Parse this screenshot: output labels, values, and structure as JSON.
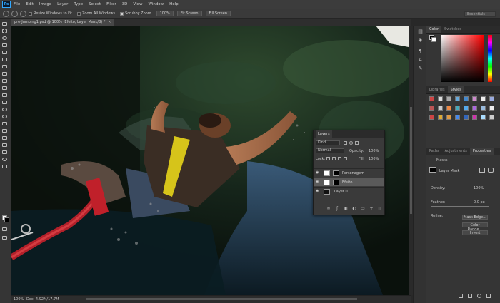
{
  "app": {
    "logo": "Ps"
  },
  "menu": [
    "File",
    "Edit",
    "Image",
    "Layer",
    "Type",
    "Select",
    "Filter",
    "3D",
    "View",
    "Window",
    "Help"
  ],
  "options_bar": {
    "resize_windows_label": "Resize Windows to Fit",
    "zoom_all_windows_label": "Zoom All Windows",
    "scrubby_zoom_label": "Scrubby Zoom",
    "btn_100": "100%",
    "btn_fit_screen": "Fit Screen",
    "btn_fill_screen": "Fill Screen",
    "workspace": "Essentials"
  },
  "document": {
    "tab_title": "pre-Jumping1.psd @ 100% (Efeito, Layer Mask/8) *",
    "close_glyph": "×",
    "zoom": "100%",
    "doc_info": "Doc: 4.92M/17.7M"
  },
  "color_panel": {
    "tabs": [
      "Color",
      "Swatches"
    ]
  },
  "styles_panel": {
    "tabs": [
      "Libraries",
      "Styles"
    ],
    "swatch_colors": [
      "#c44",
      "#ddd",
      "#aaa",
      "#6ad",
      "#48c",
      "#c8c",
      "#eee",
      "#9ad",
      "#b55",
      "#ccc",
      "#e84",
      "#4ab",
      "#5ae",
      "#a6d",
      "#9bd",
      "#eee",
      "#c44",
      "#da3",
      "#d94",
      "#48e",
      "#36b",
      "#c3a",
      "#adf",
      "#ccc"
    ]
  },
  "properties_panel": {
    "tabs": [
      "Paths",
      "Adjustments",
      "Properties"
    ],
    "masks_label": "Masks",
    "layer_mask_label": "Layer Mask",
    "density_label": "Density:",
    "density_value": "100%",
    "feather_label": "Feather:",
    "feather_value": "0.0 px",
    "refine_label": "Refine:",
    "mask_edge_btn": "Mask Edge...",
    "color_range_btn": "Color Range...",
    "invert_btn": "Invert"
  },
  "layers_panel": {
    "tab": "Layers",
    "kind_label": "Kind",
    "blend_mode": "Normal",
    "opacity_label": "Opacity:",
    "opacity_value": "100%",
    "lock_label": "Lock:",
    "fill_label": "Fill:",
    "fill_value": "100%",
    "layers": [
      {
        "name": "Personagem",
        "selected": false
      },
      {
        "name": "Efeito",
        "selected": true
      },
      {
        "name": "Layer 0",
        "selected": false
      }
    ]
  }
}
